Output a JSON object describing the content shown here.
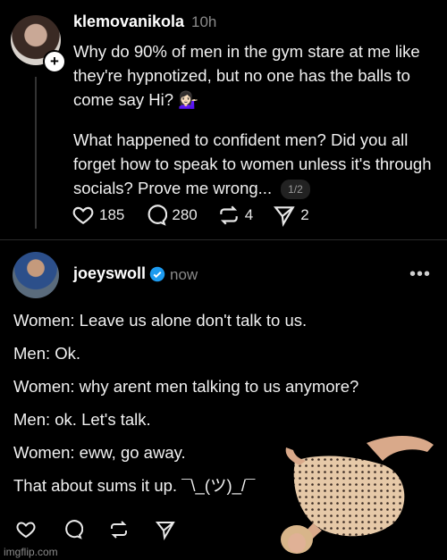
{
  "post1": {
    "username": "klemovanikola",
    "time": "10h",
    "paragraph1": "Why do 90% of men in the gym stare at me like they're hypnotized, but no one has the balls to come say Hi? 💁🏻‍♀️",
    "paragraph2": "What happened to confident men? Did you all forget how to speak to women unless it's through socials? Prove me wrong...",
    "pager": "1/2",
    "likes": "185",
    "comments": "280",
    "reposts": "4",
    "shares": "2"
  },
  "post2": {
    "username": "joeyswoll",
    "time": "now",
    "lines": [
      "Women: Leave us alone don't talk to us.",
      "Men: Ok.",
      "Women: why arent men talking to us anymore?",
      "Men: ok. Let's talk.",
      "Women: eww, go away.",
      "That about sums it up. ¯\\_(ツ)_/¯"
    ]
  },
  "watermark": "imgflip.com",
  "colors": {
    "background": "#000000",
    "text": "#f1f1f1",
    "muted": "#8a8a8a",
    "verified": "#1d9bf0"
  }
}
